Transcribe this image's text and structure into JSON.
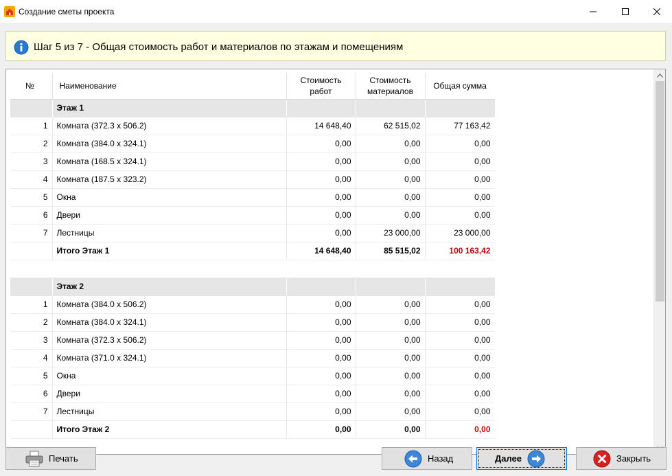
{
  "window": {
    "title": "Создание сметы проекта"
  },
  "banner": {
    "text": "Шаг 5 из 7 - Общая стоимость работ и материалов по этажам и помещениям"
  },
  "table": {
    "headers": {
      "num": "№",
      "name": "Наименование",
      "work_line1": "Стоимость",
      "work_line2": "работ",
      "mat_line1": "Стоимость",
      "mat_line2": "материалов",
      "total": "Общая сумма"
    },
    "floors": [
      {
        "title": "Этаж 1",
        "rows": [
          {
            "num": "1",
            "name": "Комната (372.3 x 506.2)",
            "work": "14 648,40",
            "materials": "62 515,02",
            "total": "77 163,42"
          },
          {
            "num": "2",
            "name": "Комната (384.0 x 324.1)",
            "work": "0,00",
            "materials": "0,00",
            "total": "0,00"
          },
          {
            "num": "3",
            "name": "Комната (168.5 x 324.1)",
            "work": "0,00",
            "materials": "0,00",
            "total": "0,00"
          },
          {
            "num": "4",
            "name": "Комната (187.5 x 323.2)",
            "work": "0,00",
            "materials": "0,00",
            "total": "0,00"
          },
          {
            "num": "5",
            "name": "Окна",
            "work": "0,00",
            "materials": "0,00",
            "total": "0,00"
          },
          {
            "num": "6",
            "name": "Двери",
            "work": "0,00",
            "materials": "0,00",
            "total": "0,00"
          },
          {
            "num": "7",
            "name": "Лестницы",
            "work": "0,00",
            "materials": "23 000,00",
            "total": "23 000,00"
          }
        ],
        "total": {
          "label": "Итого Этаж 1",
          "work": "14 648,40",
          "materials": "85 515,02",
          "total": "100 163,42"
        }
      },
      {
        "title": "Этаж 2",
        "rows": [
          {
            "num": "1",
            "name": "Комната (384.0 x 506.2)",
            "work": "0,00",
            "materials": "0,00",
            "total": "0,00"
          },
          {
            "num": "2",
            "name": "Комната (384.0 x 324.1)",
            "work": "0,00",
            "materials": "0,00",
            "total": "0,00"
          },
          {
            "num": "3",
            "name": "Комната (372.3 x 506.2)",
            "work": "0,00",
            "materials": "0,00",
            "total": "0,00"
          },
          {
            "num": "4",
            "name": "Комната (371.0 x 324.1)",
            "work": "0,00",
            "materials": "0,00",
            "total": "0,00"
          },
          {
            "num": "5",
            "name": "Окна",
            "work": "0,00",
            "materials": "0,00",
            "total": "0,00"
          },
          {
            "num": "6",
            "name": "Двери",
            "work": "0,00",
            "materials": "0,00",
            "total": "0,00"
          },
          {
            "num": "7",
            "name": "Лестницы",
            "work": "0,00",
            "materials": "0,00",
            "total": "0,00"
          }
        ],
        "total": {
          "label": "Итого Этаж 2",
          "work": "0,00",
          "materials": "0,00",
          "total": "0,00"
        }
      }
    ]
  },
  "buttons": {
    "print": "Печать",
    "back": "Назад",
    "next": "Далее",
    "close": "Закрыть"
  },
  "colors": {
    "banner_bg": "#ffffe1",
    "floor_row_bg": "#e6e6e6",
    "total_red": "#c00000",
    "accent": "#0078d7"
  },
  "icons": {
    "app": "house-icon",
    "info": "info-icon",
    "print": "printer-icon",
    "back": "arrow-left-icon",
    "next": "arrow-right-icon",
    "close": "close-circle-icon"
  }
}
